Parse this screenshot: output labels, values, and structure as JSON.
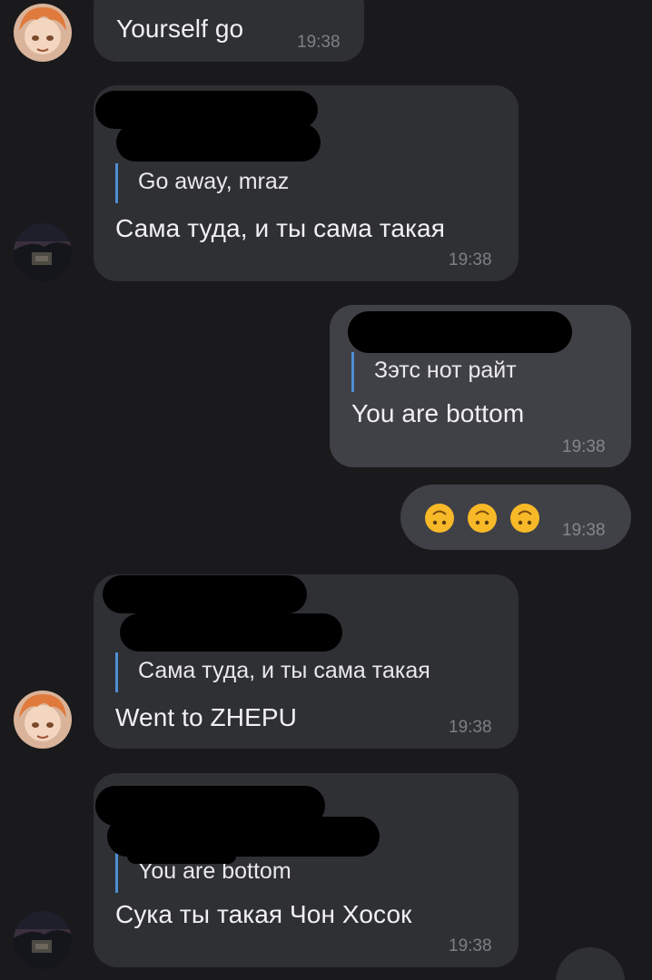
{
  "messages": [
    {
      "text": "Yourself go",
      "time": "19:38"
    },
    {
      "reply_quote": "Go away, mraz",
      "text": "Сама туда, и ты сама такая",
      "time": "19:38"
    },
    {
      "reply_quote": "Зэтс нот райт",
      "text": "You are bottom",
      "time": "19:38"
    },
    {
      "emoji": [
        "🙃",
        "🙃",
        "🙃"
      ],
      "time": "19:38"
    },
    {
      "reply_quote": "Сама туда, и ты сама такая",
      "text": "Went to ZHEPU",
      "time": "19:38"
    },
    {
      "reply_quote": "You are bottom",
      "text": "Сука ты такая Чон Хосок",
      "time": "19:38"
    }
  ],
  "colors": {
    "background": "#1a1a1c",
    "incoming_bubble": "#2f3033",
    "outgoing_bubble": "#404146",
    "reply_bar": "#4f8ed6"
  }
}
